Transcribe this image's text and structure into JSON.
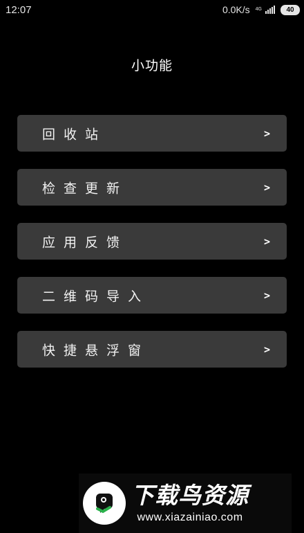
{
  "status_bar": {
    "time": "12:07",
    "net_speed": "0.0K/s",
    "net_type_top": "4G",
    "net_type_bottom": "",
    "battery": "40"
  },
  "page": {
    "title": "小功能"
  },
  "menu": {
    "items": [
      {
        "label": "回收站",
        "arrow": ">"
      },
      {
        "label": "检查更新",
        "arrow": ">"
      },
      {
        "label": "应用反馈",
        "arrow": ">"
      },
      {
        "label": "二维码导入",
        "arrow": ">"
      },
      {
        "label": "快捷悬浮窗",
        "arrow": ">"
      }
    ]
  },
  "watermark": {
    "title": "下载鸟资源",
    "url": "www.xiazainiao.com",
    "logo_icon": "bird-logo-icon",
    "accent_color": "#2bb24c"
  }
}
